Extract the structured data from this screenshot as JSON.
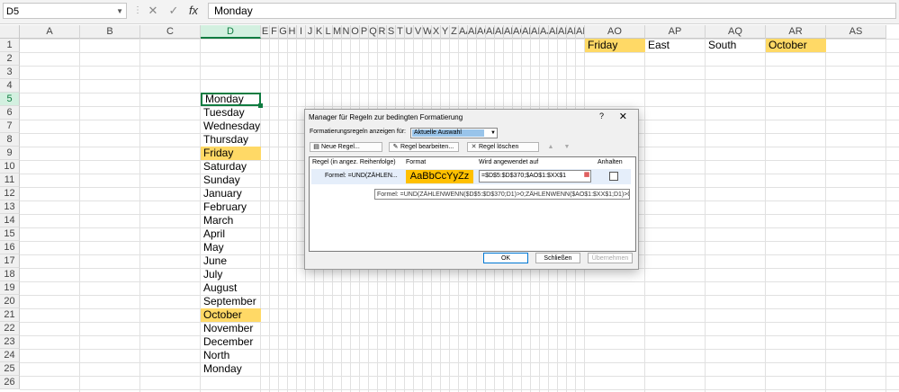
{
  "formula_bar": {
    "name_box": "D5",
    "cancel_icon": "✕",
    "enter_icon": "✓",
    "function_icon": "fx",
    "value": "Monday"
  },
  "columns": [
    {
      "label": "A",
      "w": 67
    },
    {
      "label": "B",
      "w": 67
    },
    {
      "label": "C",
      "w": 67
    },
    {
      "label": "D",
      "w": 67
    },
    {
      "label": "E",
      "w": 10
    },
    {
      "label": "F",
      "w": 10
    },
    {
      "label": "G",
      "w": 10
    },
    {
      "label": "H",
      "w": 10
    },
    {
      "label": "I",
      "w": 10
    },
    {
      "label": "J",
      "w": 10
    },
    {
      "label": "K",
      "w": 10
    },
    {
      "label": "L",
      "w": 10
    },
    {
      "label": "M",
      "w": 10
    },
    {
      "label": "N",
      "w": 10
    },
    {
      "label": "O",
      "w": 10
    },
    {
      "label": "P",
      "w": 10
    },
    {
      "label": "Q",
      "w": 10
    },
    {
      "label": "R",
      "w": 10
    },
    {
      "label": "S",
      "w": 10
    },
    {
      "label": "T",
      "w": 10
    },
    {
      "label": "U",
      "w": 10
    },
    {
      "label": "V",
      "w": 10
    },
    {
      "label": "W",
      "w": 10
    },
    {
      "label": "X",
      "w": 10
    },
    {
      "label": "Y",
      "w": 10
    },
    {
      "label": "Z",
      "w": 10
    },
    {
      "label": "AA",
      "w": 10
    },
    {
      "label": "AB",
      "w": 10
    },
    {
      "label": "AC",
      "w": 10
    },
    {
      "label": "AD",
      "w": 10
    },
    {
      "label": "AE",
      "w": 10
    },
    {
      "label": "AF",
      "w": 10
    },
    {
      "label": "AG",
      "w": 10
    },
    {
      "label": "AH",
      "w": 10
    },
    {
      "label": "AI",
      "w": 10
    },
    {
      "label": "AJ",
      "w": 10
    },
    {
      "label": "AK",
      "w": 10
    },
    {
      "label": "AL",
      "w": 10
    },
    {
      "label": "AM",
      "w": 10
    },
    {
      "label": "AN",
      "w": 10
    },
    {
      "label": "AO",
      "w": 67
    },
    {
      "label": "AP",
      "w": 67
    },
    {
      "label": "AQ",
      "w": 67
    },
    {
      "label": "AR",
      "w": 67
    },
    {
      "label": "AS",
      "w": 67
    }
  ],
  "active_column": "D",
  "rows": [
    "1",
    "2",
    "3",
    "4",
    "5",
    "6",
    "7",
    "8",
    "9",
    "10",
    "11",
    "12",
    "13",
    "14",
    "15",
    "16",
    "17",
    "18",
    "19",
    "20",
    "21",
    "22",
    "23",
    "24",
    "25",
    "26"
  ],
  "active_row": "5",
  "cells": [
    {
      "col": "AO",
      "row": 1,
      "value": "Friday",
      "hl": true
    },
    {
      "col": "AP",
      "row": 1,
      "value": "East",
      "hl": false
    },
    {
      "col": "AQ",
      "row": 1,
      "value": "South",
      "hl": false
    },
    {
      "col": "AR",
      "row": 1,
      "value": "October",
      "hl": true
    },
    {
      "col": "D",
      "row": 5,
      "value": "Monday",
      "hl": false,
      "sel": true
    },
    {
      "col": "D",
      "row": 6,
      "value": "Tuesday",
      "hl": false
    },
    {
      "col": "D",
      "row": 7,
      "value": "Wednesday",
      "hl": false
    },
    {
      "col": "D",
      "row": 8,
      "value": "Thursday",
      "hl": false
    },
    {
      "col": "D",
      "row": 9,
      "value": "Friday",
      "hl": true
    },
    {
      "col": "D",
      "row": 10,
      "value": "Saturday",
      "hl": false
    },
    {
      "col": "D",
      "row": 11,
      "value": "Sunday",
      "hl": false
    },
    {
      "col": "D",
      "row": 12,
      "value": "January",
      "hl": false
    },
    {
      "col": "D",
      "row": 13,
      "value": "February",
      "hl": false
    },
    {
      "col": "D",
      "row": 14,
      "value": "March",
      "hl": false
    },
    {
      "col": "D",
      "row": 15,
      "value": "April",
      "hl": false
    },
    {
      "col": "D",
      "row": 16,
      "value": "May",
      "hl": false
    },
    {
      "col": "D",
      "row": 17,
      "value": "June",
      "hl": false
    },
    {
      "col": "D",
      "row": 18,
      "value": "July",
      "hl": false
    },
    {
      "col": "D",
      "row": 19,
      "value": "August",
      "hl": false
    },
    {
      "col": "D",
      "row": 20,
      "value": "September",
      "hl": false
    },
    {
      "col": "D",
      "row": 21,
      "value": "October",
      "hl": true
    },
    {
      "col": "D",
      "row": 22,
      "value": "November",
      "hl": false
    },
    {
      "col": "D",
      "row": 23,
      "value": "December",
      "hl": false
    },
    {
      "col": "D",
      "row": 24,
      "value": "North",
      "hl": false
    },
    {
      "col": "D",
      "row": 25,
      "value": "Monday",
      "hl": false
    }
  ],
  "dialog": {
    "title": "Manager für Regeln zur bedingten Formatierung",
    "help": "?",
    "close": "✕",
    "show_rules_label": "Formatierungsregeln anzeigen für:",
    "show_rules_value": "Aktuelle Auswahl",
    "new_rule": "Neue Regel...",
    "edit_rule": "Regel bearbeiten...",
    "delete_rule": "Regel löschen",
    "move_up": "▲",
    "move_down": "▼",
    "headers": {
      "rule": "Regel (in angez. Reihenfolge)",
      "format": "Format",
      "applies_to": "Wird angewendet auf",
      "stop": "Anhalten"
    },
    "rule_row": {
      "rule": "Formel: =UND(ZÄHLEN...",
      "preview": "AaBbCcYyZz",
      "applies_to": "=$D$5:$D$370;$AO$1:$XX$1"
    },
    "tooltip": "Formel: =UND(ZÄHLENWENN($D$5:$D$370;D1)>0;ZÄHLENWENN($AO$1:$XX$1;D1)>0)",
    "ok": "OK",
    "close_btn": "Schließen",
    "apply": "Übernehmen"
  },
  "colors": {
    "highlight": "#ffd966",
    "format_preview": "#ffc000",
    "selection": "#107c41"
  }
}
